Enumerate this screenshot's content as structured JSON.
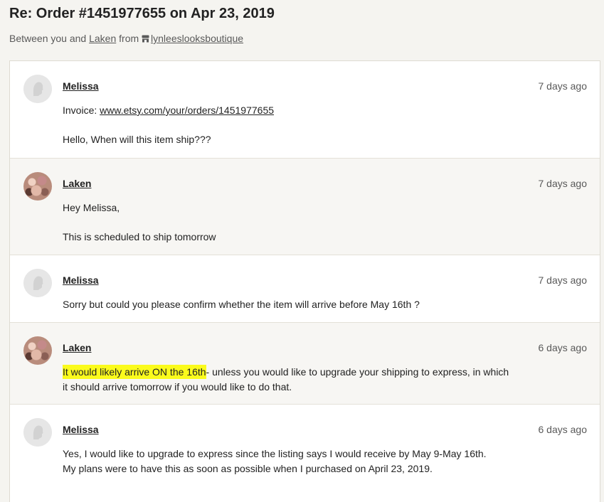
{
  "header": {
    "title": "Re: Order #1451977655 on Apr 23, 2019",
    "between_text": "Between you and",
    "partner_name": "Laken",
    "from_text": "from",
    "shop_name": "lynleeslooksboutique"
  },
  "messages": [
    {
      "sender": "Melissa",
      "time": "7 days ago",
      "invoice_label": "Invoice:",
      "invoice_link": "www.etsy.com/your/orders/1451977655",
      "text": "Hello, When will this item ship???"
    },
    {
      "sender": "Laken",
      "time": "7 days ago",
      "line1": "Hey Melissa,",
      "line2": "This is scheduled to ship tomorrow"
    },
    {
      "sender": "Melissa",
      "time": "7 days ago",
      "text": "Sorry but could you please confirm whether the item will arrive before May 16th ?"
    },
    {
      "sender": "Laken",
      "time": "6 days ago",
      "highlighted": "It would likely arrive ON the 16th",
      "text_rest": "- unless you would like to upgrade your shipping to express, in which it should arrive tomorrow if you would like to do that."
    },
    {
      "sender": "Melissa",
      "time": "6 days ago",
      "text": "Yes, I would like to upgrade to express since the listing says I would receive by May 9-May 16th. My plans were to have this as soon as possible when I purchased on April 23, 2019."
    }
  ],
  "colors": {
    "highlight": "#fbfb1c",
    "page_bg": "#f5f4f0",
    "shaded_msg_bg": "#f7f6f3"
  }
}
